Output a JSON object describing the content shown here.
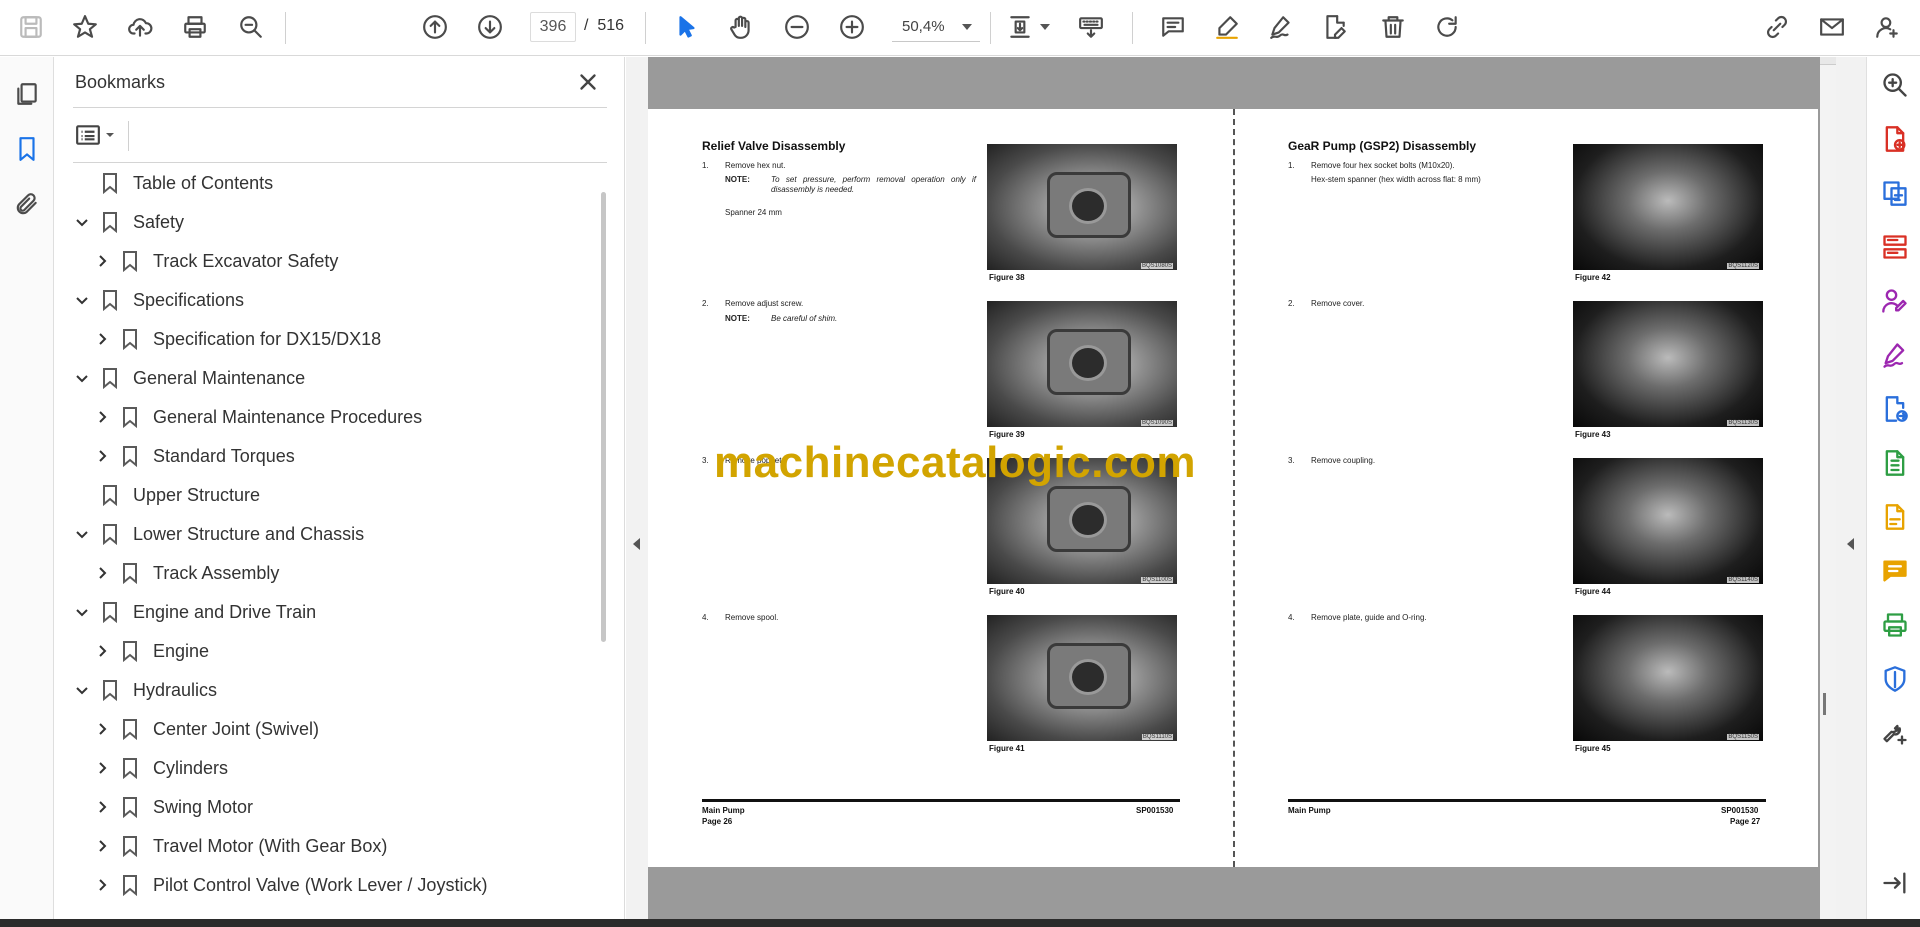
{
  "toolbar": {
    "current_page": "396",
    "page_separator": "/",
    "total_pages": "516",
    "zoom": "50,4%",
    "icons": [
      "save-icon",
      "star-icon",
      "upload-icon",
      "print-icon",
      "zoom-search-icon",
      "page-up-icon",
      "page-down-icon",
      "select-cursor-icon",
      "hand-icon",
      "zoom-out-icon",
      "zoom-in-icon",
      "fit-page-icon",
      "keyboard-icon",
      "comment-icon",
      "highlight-icon",
      "sign-icon",
      "edit-pdf-icon",
      "delete-icon",
      "rotate-icon",
      "share-link-icon",
      "mail-icon",
      "account-icon"
    ]
  },
  "left_rail": {
    "icons": [
      "pages-icon",
      "bookmark-icon",
      "attachment-icon"
    ]
  },
  "bookmarks": {
    "title": "Bookmarks",
    "items": [
      {
        "label": "Table of Contents",
        "level": 0,
        "expander": "none"
      },
      {
        "label": "Safety",
        "level": 0,
        "expander": "expanded"
      },
      {
        "label": "Track Excavator Safety",
        "level": 1,
        "expander": "collapsed"
      },
      {
        "label": "Specifications",
        "level": 0,
        "expander": "expanded"
      },
      {
        "label": "Specification for DX15/DX18",
        "level": 1,
        "expander": "collapsed"
      },
      {
        "label": "General Maintenance",
        "level": 0,
        "expander": "expanded"
      },
      {
        "label": "General Maintenance Procedures",
        "level": 1,
        "expander": "collapsed"
      },
      {
        "label": "Standard Torques",
        "level": 1,
        "expander": "collapsed"
      },
      {
        "label": "Upper Structure",
        "level": 0,
        "expander": "none"
      },
      {
        "label": "Lower Structure and Chassis",
        "level": 0,
        "expander": "expanded"
      },
      {
        "label": "Track Assembly",
        "level": 1,
        "expander": "collapsed"
      },
      {
        "label": "Engine and Drive Train",
        "level": 0,
        "expander": "expanded"
      },
      {
        "label": "Engine",
        "level": 1,
        "expander": "collapsed"
      },
      {
        "label": "Hydraulics",
        "level": 0,
        "expander": "expanded"
      },
      {
        "label": "Center Joint (Swivel)",
        "level": 1,
        "expander": "collapsed"
      },
      {
        "label": "Cylinders",
        "level": 1,
        "expander": "collapsed"
      },
      {
        "label": "Swing Motor",
        "level": 1,
        "expander": "collapsed"
      },
      {
        "label": "Travel Motor (With Gear Box)",
        "level": 1,
        "expander": "collapsed"
      },
      {
        "label": "Pilot Control Valve (Work Lever / Joystick)",
        "level": 1,
        "expander": "collapsed"
      }
    ]
  },
  "document": {
    "watermark": "machinecatalogic.com",
    "left_page": {
      "heading": "Relief Valve Disassembly",
      "steps": [
        {
          "num": "1.",
          "text": "Remove hex nut.",
          "note_label": "NOTE:",
          "note": "To set pressure, perform removal operation only if disassembly is needed.",
          "extra": "Spanner 24 mm"
        },
        {
          "num": "2.",
          "text": "Remove adjust screw.",
          "note_label": "NOTE:",
          "note": "Be careful of shim.",
          "extra": ""
        },
        {
          "num": "3.",
          "text": "Remove poppet.",
          "note_label": "",
          "note": "",
          "extra": ""
        },
        {
          "num": "4.",
          "text": "Remove spool.",
          "note_label": "",
          "note": "",
          "extra": ""
        }
      ],
      "figures": [
        {
          "caption": "Figure 38",
          "code": "BQS1080S"
        },
        {
          "caption": "Figure 39",
          "code": "BQS1090S"
        },
        {
          "caption": "Figure 40",
          "code": "BQS1100S"
        },
        {
          "caption": "Figure 41",
          "code": "BQS1110S"
        }
      ],
      "footer_left": "Main Pump",
      "footer_page": "Page 26",
      "footer_right": "SP001530"
    },
    "right_page": {
      "heading": "GeaR Pump (GSP2) Disassembly",
      "steps": [
        {
          "num": "1.",
          "text": "Remove four hex socket bolts (M10x20).",
          "extra": "Hex-stem spanner (hex width across flat: 8 mm)"
        },
        {
          "num": "2.",
          "text": "Remove cover.",
          "extra": ""
        },
        {
          "num": "3.",
          "text": "Remove coupling.",
          "extra": ""
        },
        {
          "num": "4.",
          "text": "Remove plate, guide and O-ring.",
          "extra": ""
        }
      ],
      "figures": [
        {
          "caption": "Figure 42",
          "code": "BQS1120S"
        },
        {
          "caption": "Figure 43",
          "code": "BQS1130S"
        },
        {
          "caption": "Figure 44",
          "code": "BQS1140S"
        },
        {
          "caption": "Figure 45",
          "code": "BQS1150S"
        }
      ],
      "footer_left": "Main Pump",
      "footer_page": "Page 27",
      "footer_right": "SP001530"
    }
  },
  "right_rail": {
    "icons": [
      "zoom-tool-icon",
      "create-pdf-icon",
      "export-pdf-icon",
      "organize-pages-icon",
      "fill-sign-icon",
      "request-signature-icon",
      "send-for-review-icon",
      "compress-icon",
      "export-file-icon",
      "comment-tool-icon",
      "print-production-icon",
      "protect-icon",
      "more-tools-icon",
      "expand-panel-icon"
    ],
    "colors": {
      "red": "#d93025",
      "blue": "#2a6fdb",
      "purple": "#9c27b0",
      "yellow": "#e8a300",
      "green": "#2e9e44"
    }
  }
}
